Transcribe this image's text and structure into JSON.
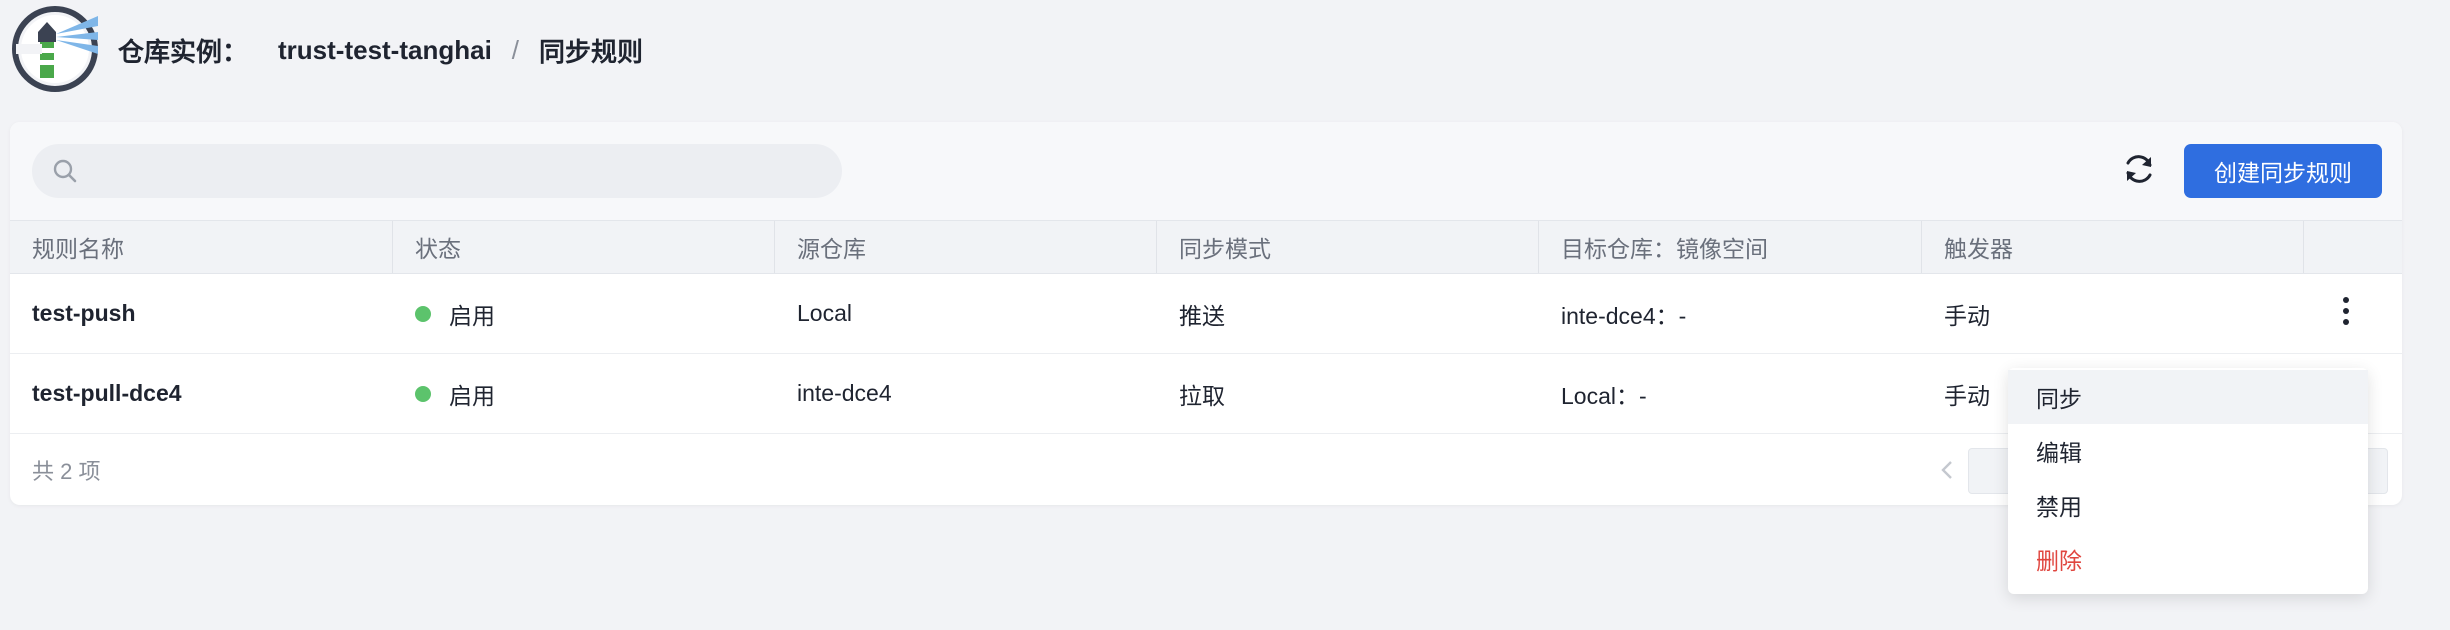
{
  "breadcrumb": {
    "label": "仓库实例：",
    "instance": "trust-test-tanghai",
    "separator": "/",
    "current": "同步规则"
  },
  "toolbar": {
    "search_placeholder": "",
    "refresh_icon": "refresh-icon",
    "create_label": "创建同步规则"
  },
  "table": {
    "columns": [
      "规则名称",
      "状态",
      "源仓库",
      "同步模式",
      "目标仓库：镜像空间",
      "触发器",
      ""
    ],
    "rows": [
      {
        "name": "test-push",
        "status": "启用",
        "source": "Local",
        "mode": "推送",
        "target": "inte-dce4：-",
        "trigger": "手动"
      },
      {
        "name": "test-pull-dce4",
        "status": "启用",
        "source": "inte-dce4",
        "mode": "拉取",
        "target": "Local：-",
        "trigger": "手动"
      }
    ]
  },
  "footer": {
    "total": "共 2 项"
  },
  "menu": {
    "items": [
      "同步",
      "编辑",
      "禁用",
      "删除"
    ]
  },
  "colors": {
    "primary": "#2f6ee0",
    "status_enabled": "#5cc36c",
    "danger": "#e0463f"
  }
}
